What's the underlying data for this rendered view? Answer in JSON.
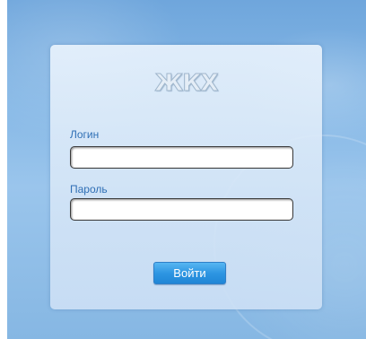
{
  "login_form": {
    "logo_text": "ЖКХ",
    "login_label": "Логин",
    "login_value": "",
    "password_label": "Пароль",
    "password_value": "",
    "submit_label": "Войти"
  },
  "colors": {
    "background": "#86b8e6",
    "panel": "#e2eefa",
    "label": "#2f6fb5",
    "button": "#2e96e2",
    "button_text": "#ffffff"
  }
}
